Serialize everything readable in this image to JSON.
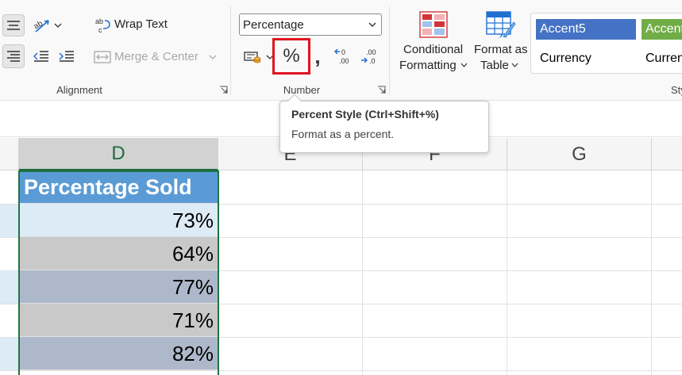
{
  "ribbon": {
    "alignment": {
      "label": "Alignment",
      "wrap_text_label": "Wrap Text",
      "merge_center_label": "Merge & Center"
    },
    "number": {
      "label": "Number",
      "format_value": "Percentage",
      "percent_symbol": "%",
      "comma_symbol": ","
    },
    "styles": {
      "conditional_formatting_line1": "Conditional",
      "conditional_formatting_line2": "Formatting",
      "format_as_table_line1": "Format as",
      "format_as_table_line2": "Table",
      "label_partial": "Sty",
      "cells": [
        {
          "label": "Accent5",
          "color": "#4472c4"
        },
        {
          "label": "Accent",
          "color": "#70ad47"
        },
        {
          "label": "Currency"
        },
        {
          "label": "Curren"
        }
      ]
    }
  },
  "tooltip": {
    "title": "Percent Style (Ctrl+Shift+%)",
    "description": "Format as a percent."
  },
  "sheet": {
    "columns": [
      "D",
      "E",
      "F",
      "G"
    ],
    "selected_column": "D",
    "header_cell": "Percentage Sold",
    "values": [
      "73%",
      "64%",
      "77%",
      "71%",
      "82%"
    ],
    "row_colors": [
      "#ddebf7",
      "#c9c9c9",
      "#adb9ca",
      "#c9c9c9",
      "#adb9ca"
    ]
  },
  "colors": {
    "accent_green": "#217346",
    "header_blue": "#5b9bd5",
    "highlight_red": "#e0141e"
  }
}
